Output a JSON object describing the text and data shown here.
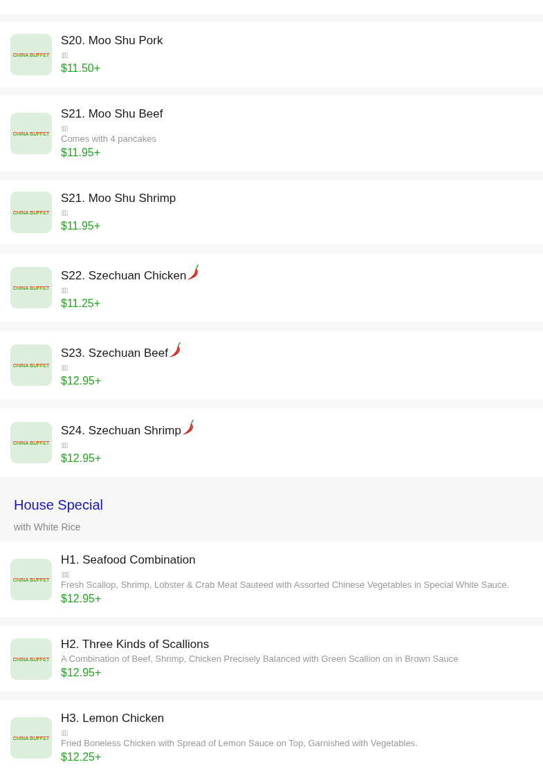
{
  "sections": [
    {
      "items": [
        {
          "name": "S20. Moo Shu Pork",
          "spicy": false,
          "chinese_name": "▯▯▯",
          "price": "$11.50+",
          "thumbnail": {
            "logo_text": "CHINA BUFFET"
          }
        },
        {
          "name": "S21. Moo Shu Beef",
          "spicy": false,
          "chinese_name": "▯▯▯",
          "description": "Comes with 4 pancakes",
          "price": "$11.95+",
          "thumbnail": {
            "logo_text": "CHINA BUFFET"
          }
        },
        {
          "name": "S21. Moo Shu Shrimp",
          "spicy": false,
          "chinese_name": "▯▯▯",
          "price": "$11.95+",
          "thumbnail": {
            "logo_text": "CHINA BUFFET"
          }
        },
        {
          "name": "S22. Szechuan Chicken",
          "spicy": true,
          "chinese_name": "▯▯▯",
          "price": "$11.25+",
          "thumbnail": {
            "logo_text": "CHINA BUFFET"
          }
        },
        {
          "name": "S23. Szechuan Beef",
          "spicy": true,
          "chinese_name": "▯▯▯",
          "price": "$12.95+",
          "thumbnail": {
            "logo_text": "CHINA BUFFET"
          }
        },
        {
          "name": "S24. Szechuan Shrimp",
          "spicy": true,
          "chinese_name": "▯▯▯",
          "price": "$12.95+",
          "thumbnail": {
            "logo_text": "CHINA BUFFET"
          }
        }
      ]
    },
    {
      "title": "House Special",
      "subtitle": "with White Rice",
      "items": [
        {
          "name": "H1. Seafood Combination",
          "spicy": false,
          "chinese_name": "▯▯▯▯",
          "description": "Fresh Scallop, Shrimp, Lobster & Crab Meat Sauteed with Assorted Chinese Vegetables in Special White Sauce.",
          "price": "$12.95+",
          "thumbnail": {
            "logo_text": "CHINA BUFFET"
          }
        },
        {
          "name": "H2. Three Kinds of Scallions",
          "spicy": false,
          "description": "A Combination of Beef, Shrimp, Chicken Precisely Balanced with Green Scallion on in Brown Sauce",
          "price": "$12.95+",
          "thumbnail": {
            "logo_text": "CHINA BUFFET"
          }
        },
        {
          "name": "H3. Lemon Chicken",
          "spicy": false,
          "chinese_name": "▯▯▯",
          "description": "Fried Boneless Chicken with Spread of Lemon Sauce on Top, Garnished with Vegetables.",
          "price": "$12.25+",
          "thumbnail": {
            "logo_text": "CHINA BUFFET"
          }
        }
      ]
    }
  ]
}
